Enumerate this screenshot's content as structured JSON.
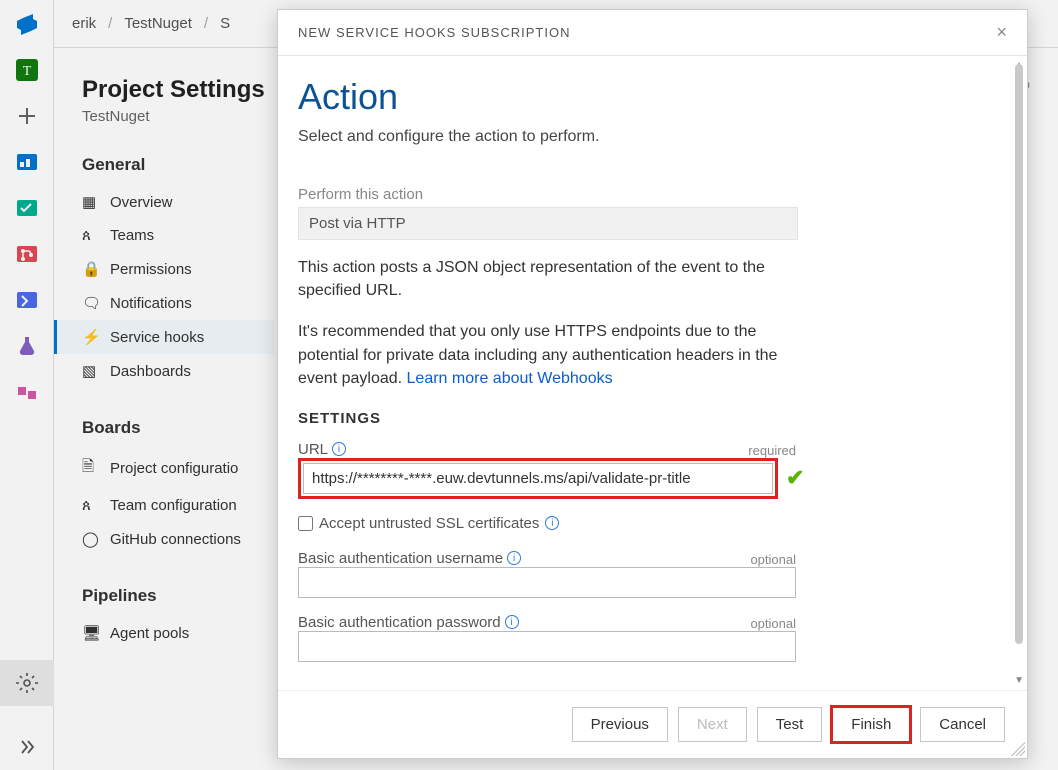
{
  "breadcrumb": {
    "user": "erik",
    "project": "TestNuget"
  },
  "settings": {
    "title": "Project Settings",
    "project": "TestNuget",
    "sections": {
      "general": {
        "head": "General",
        "overview": "Overview",
        "teams": "Teams",
        "permissions": "Permissions",
        "notifications": "Notifications",
        "service_hooks": "Service hooks",
        "dashboards": "Dashboards"
      },
      "boards": {
        "head": "Boards",
        "proj_conf": "Project configuratio",
        "team_conf": "Team configuration",
        "github": "GitHub connections"
      },
      "pipelines": {
        "head": "Pipelines",
        "agent_pools": "Agent pools"
      }
    }
  },
  "right_hint": "pro",
  "modal": {
    "title": "NEW SERVICE HOOKS SUBSCRIPTION",
    "heading": "Action",
    "subheading": "Select and configure the action to perform.",
    "perform_label": "Perform this action",
    "perform_value": "Post via HTTP",
    "desc1": "This action posts a JSON object representation of the event to the specified URL.",
    "desc2_a": "It's recommended that you only use HTTPS endpoints due to the potential for private data including any authentication headers in the event payload. ",
    "desc2_link": "Learn more about Webhooks",
    "settings_head": "SETTINGS",
    "url": {
      "label": "URL",
      "req": "required",
      "value": "https://********-****.euw.devtunnels.ms/api/validate-pr-title"
    },
    "ssl_label": "Accept untrusted SSL certificates",
    "basic_user": {
      "label": "Basic authentication username",
      "req": "optional",
      "value": ""
    },
    "basic_pass": {
      "label": "Basic authentication password",
      "req": "optional",
      "value": ""
    },
    "buttons": {
      "previous": "Previous",
      "next": "Next",
      "test": "Test",
      "finish": "Finish",
      "cancel": "Cancel"
    }
  }
}
